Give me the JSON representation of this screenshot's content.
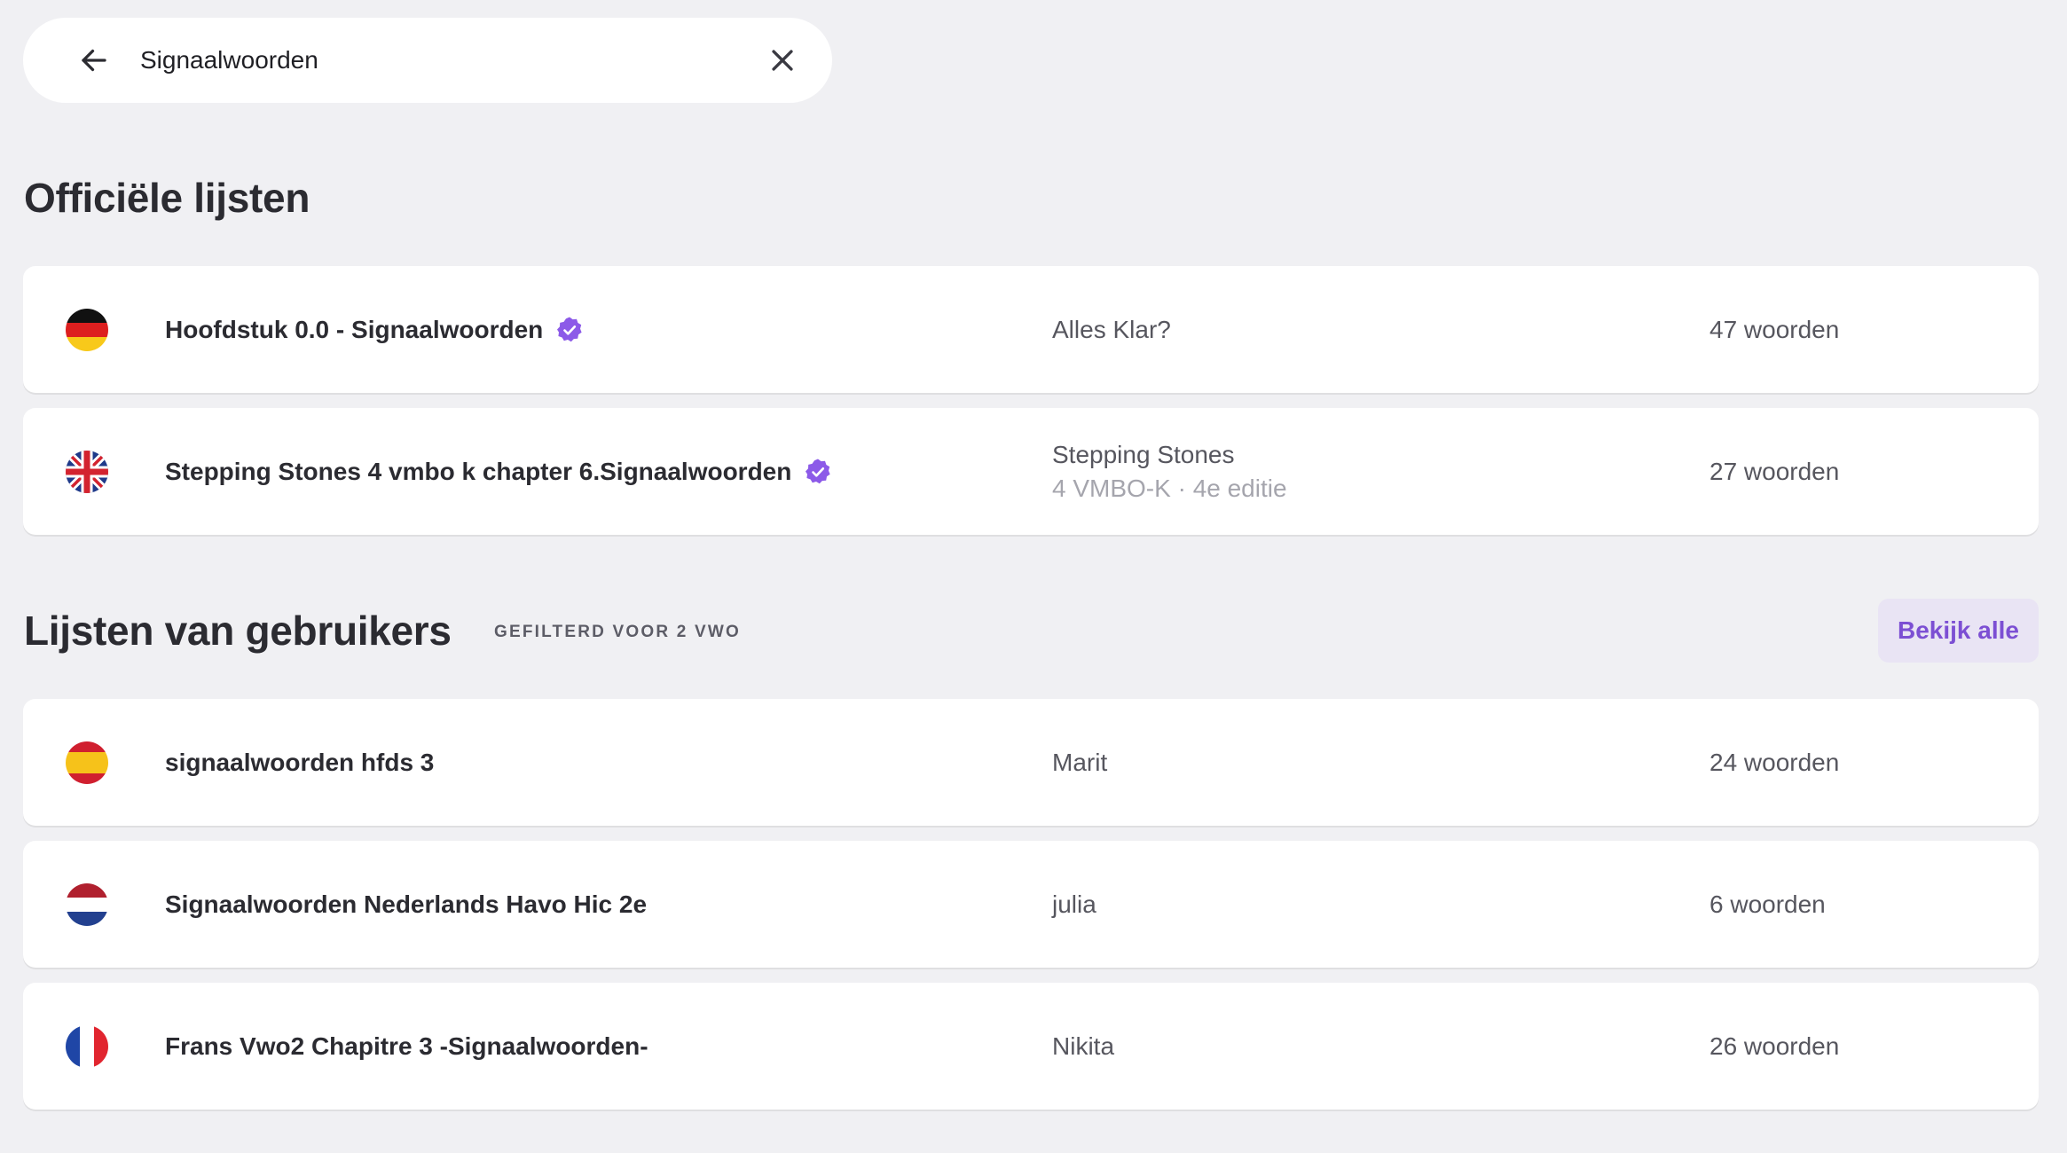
{
  "search": {
    "query": "Signaalwoorden"
  },
  "official": {
    "title": "Officiële lijsten",
    "items": [
      {
        "title": "Hoofdstuk 0.0 - Signaalwoorden",
        "flag": "germany-flag-icon",
        "verified": true,
        "source": "Alles Klar?",
        "source_sub": "",
        "count": "47 woorden"
      },
      {
        "title": "Stepping Stones 4 vmbo k chapter 6.Signaalwoorden",
        "flag": "uk-flag-icon",
        "verified": true,
        "source": "Stepping Stones",
        "source_sub": "4 VMBO-K · 4e editie",
        "count": "27 woorden"
      }
    ]
  },
  "users": {
    "title": "Lijsten van gebruikers",
    "filter_label": "GEFILTERD VOOR 2 VWO",
    "view_all_label": "Bekijk alle",
    "items": [
      {
        "title": "signaalwoorden hfds 3",
        "flag": "spain-flag-icon",
        "source": "Marit",
        "count": "24 woorden"
      },
      {
        "title": "Signaalwoorden Nederlands Havo Hic 2e",
        "flag": "netherlands-flag-icon",
        "source": "julia",
        "count": "6 woorden"
      },
      {
        "title": "Frans Vwo2 Chapitre 3 -Signaalwoorden-",
        "flag": "france-flag-icon",
        "source": "Nikita",
        "count": "26 woorden"
      }
    ]
  },
  "colors": {
    "accent": "#7c4fd3",
    "background": "#f0f0f3",
    "card": "#ffffff"
  }
}
